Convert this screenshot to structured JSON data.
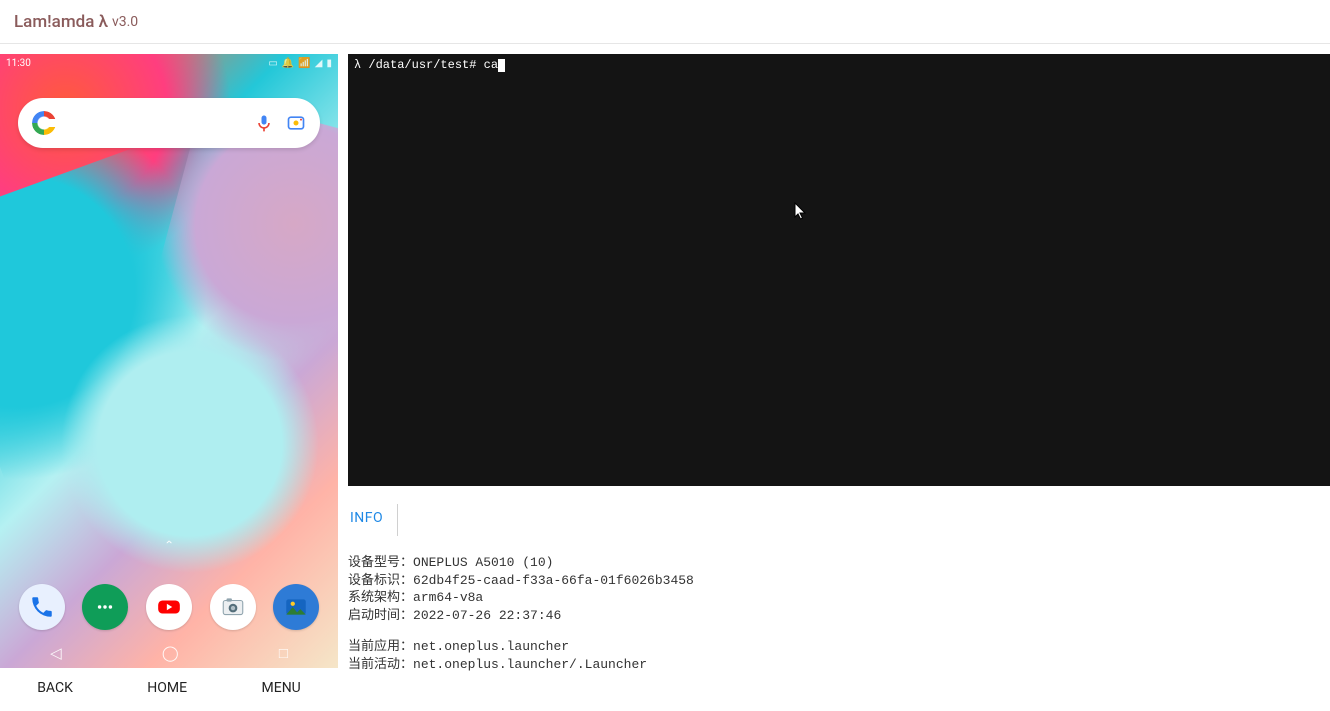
{
  "header": {
    "brand": "Lam!amda λ",
    "version": "v3.0"
  },
  "device": {
    "status_time": "11:30",
    "search_placeholder": "",
    "dock": [
      {
        "name": "phone"
      },
      {
        "name": "messages"
      },
      {
        "name": "youtube"
      },
      {
        "name": "camera"
      },
      {
        "name": "gallery"
      }
    ],
    "controls": {
      "back": "BACK",
      "home": "HOME",
      "menu": "MENU"
    }
  },
  "terminal": {
    "prompt_symbol": "λ",
    "cwd": "/data/usr/test",
    "prompt_suffix": "#",
    "input": "ca"
  },
  "info": {
    "tab_label": "INFO",
    "rows": [
      {
        "label": "设备型号：",
        "value": "ONEPLUS A5010 (10)"
      },
      {
        "label": "设备标识：",
        "value": "62db4f25-caad-f33a-66fa-01f6026b3458"
      },
      {
        "label": "系统架构：",
        "value": "arm64-v8a"
      },
      {
        "label": "启动时间：",
        "value": "2022-07-26 22:37:46"
      }
    ],
    "rows2": [
      {
        "label": "当前应用：",
        "value": "net.oneplus.launcher"
      },
      {
        "label": "当前活动：",
        "value": "net.oneplus.launcher/.Launcher"
      }
    ]
  }
}
